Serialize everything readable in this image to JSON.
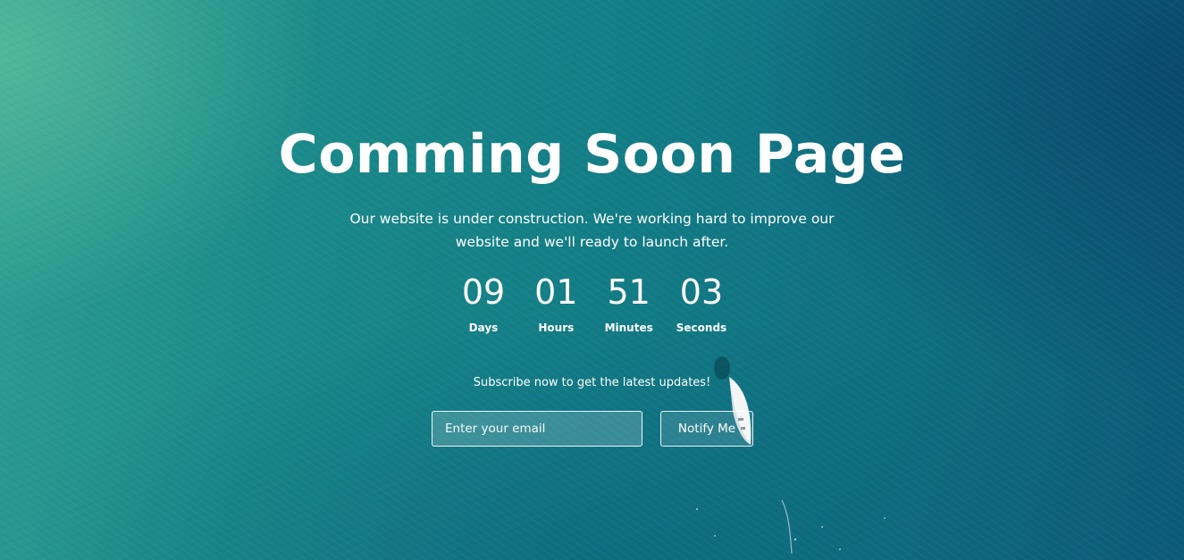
{
  "hero": {
    "title": "Comming Soon Page",
    "description": "Our website is under construction. We're working hard to improve our website and we'll ready to launch after."
  },
  "countdown": [
    {
      "value": "09",
      "label": "Days"
    },
    {
      "value": "01",
      "label": "Hours"
    },
    {
      "value": "51",
      "label": "Minutes"
    },
    {
      "value": "03",
      "label": "Seconds"
    }
  ],
  "subscribe": {
    "text": "Subscribe now to get the latest updates!",
    "email_placeholder": "Enter your email",
    "email_value": "",
    "button_label": "Notify Me"
  },
  "colors": {
    "background_start": "#2e9e92",
    "background_end": "#0c5a76",
    "text": "#ffffff"
  },
  "decor": {
    "background_image": "aerial-sea-with-boat"
  }
}
